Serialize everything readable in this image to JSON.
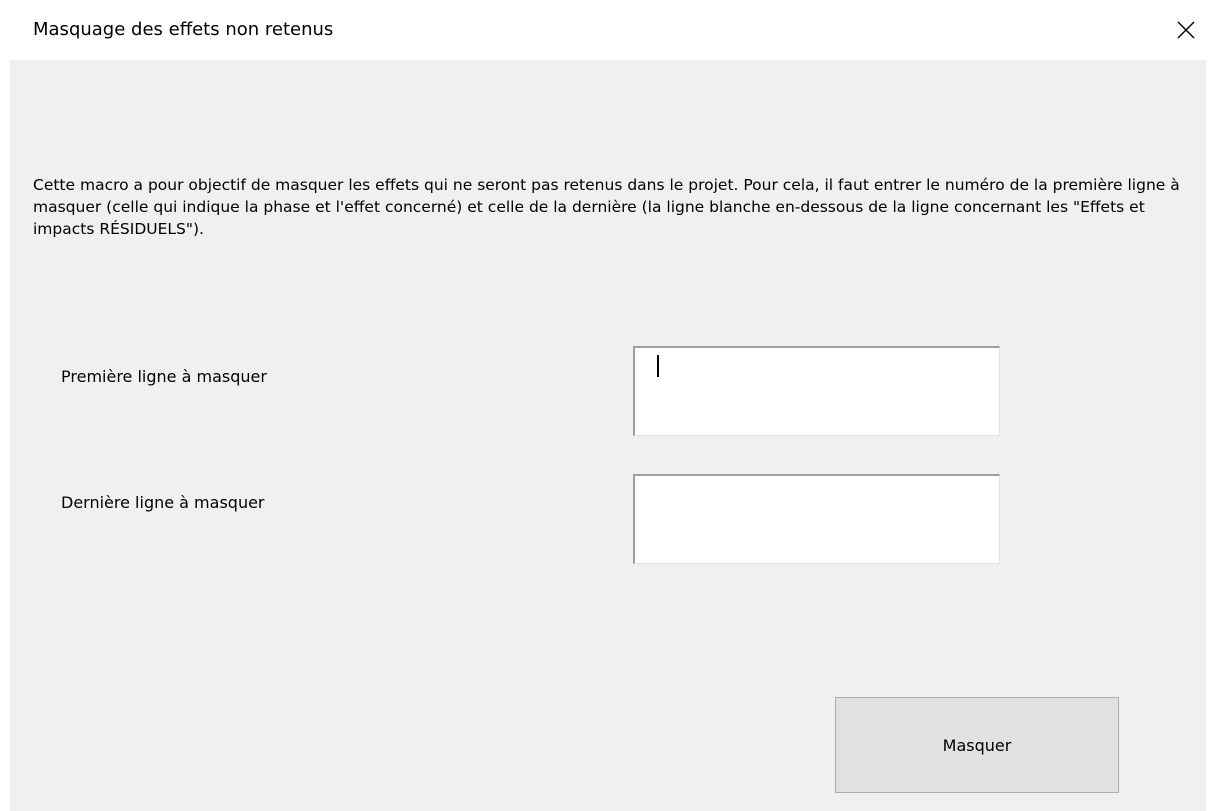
{
  "window": {
    "title": "Masquage des effets non retenus",
    "close_icon": "close-icon"
  },
  "form": {
    "description": "Cette macro a pour objectif de masquer les effets qui ne seront pas retenus dans le projet. Pour cela, il faut entrer le numéro de la première ligne à masquer (celle qui indique la phase et l'effet concerné) et celle de la dernière (la ligne blanche en-dessous de la ligne concernant les \"Effets et impacts RÉSIDUELS\").",
    "first_line_label": "Première ligne à masquer",
    "first_line_value": "",
    "last_line_label": "Dernière ligne à masquer",
    "last_line_value": "",
    "submit_label": "Masquer"
  },
  "colors": {
    "dialog_background": "#f0f0f0",
    "titlebar_background": "#ffffff",
    "button_background": "#e1e1e1"
  }
}
